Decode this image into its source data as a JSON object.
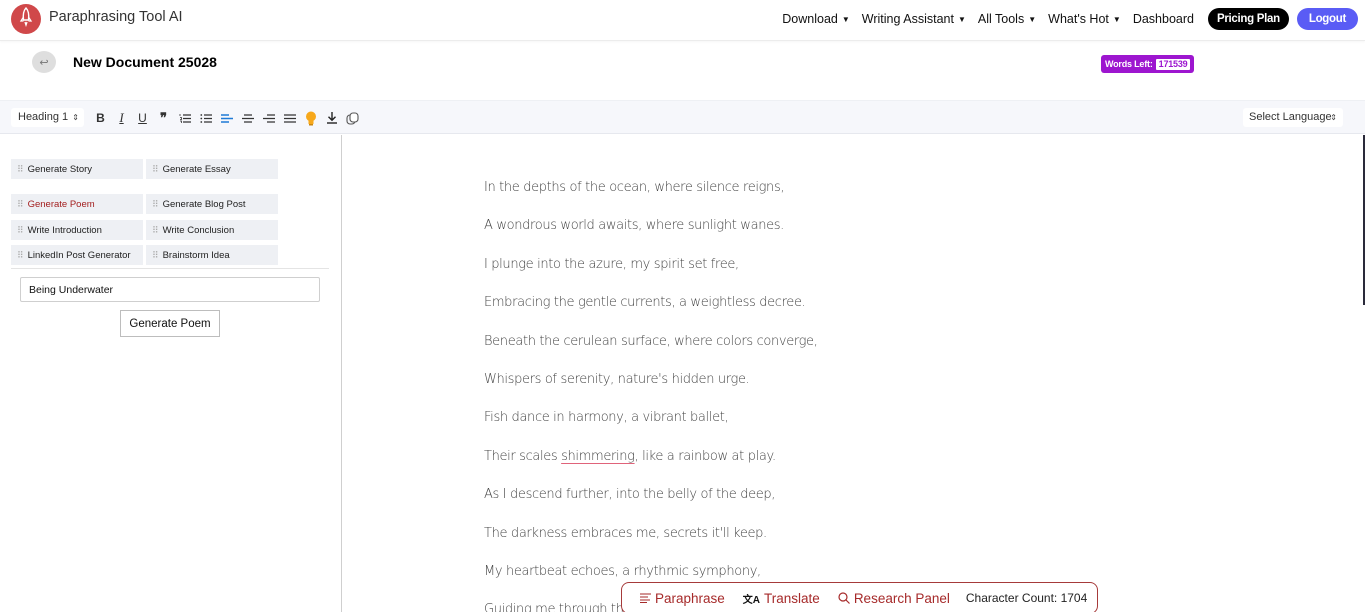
{
  "app": {
    "brand": "Paraphrasing Tool AI",
    "logo_icon": "rocket-icon",
    "brand_color": "#d0484a"
  },
  "nav": {
    "items": [
      {
        "label": "Download",
        "has_dropdown": true
      },
      {
        "label": "Writing Assistant",
        "has_dropdown": true
      },
      {
        "label": "All Tools",
        "has_dropdown": true
      },
      {
        "label": "What's Hot",
        "has_dropdown": true
      },
      {
        "label": "Dashboard",
        "has_dropdown": false
      }
    ],
    "caret": "▼",
    "pricing_label": "Pricing Plan",
    "logout_label": "Logout",
    "logout_color": "#5a5cf5"
  },
  "document": {
    "back_icon": "↩",
    "title": "New Document 25028",
    "words_left_label": "Words Left:",
    "words_left_value": "171539",
    "words_left_color": "#9d16cf"
  },
  "toolbar": {
    "heading_select": "Heading 1",
    "select_arrows": "⇕",
    "buttons": [
      "bold",
      "italic",
      "underline",
      "blockquote",
      "ordered-list",
      "bullet-list",
      "align-left",
      "align-center",
      "align-right",
      "justify",
      "idea",
      "download",
      "copy"
    ],
    "bold_glyph": "B",
    "italic_glyph": "I",
    "underline_glyph": "U",
    "quote_glyph": "❞",
    "language_select": "Select Language"
  },
  "tools": {
    "grip": "⠿",
    "items": [
      {
        "label": "Generate Story",
        "active": false
      },
      {
        "label": "Generate Essay",
        "active": false
      },
      {
        "label": "Generate Poem",
        "active": true
      },
      {
        "label": "Generate Blog Post",
        "active": false
      },
      {
        "label": "Write Introduction",
        "active": false
      },
      {
        "label": "Write Conclusion",
        "active": false
      },
      {
        "label": "LinkedIn Post Generator",
        "active": false
      },
      {
        "label": "Brainstorm Idea",
        "active": false
      }
    ],
    "topic_value": "Being Underwater",
    "generate_label": "Generate Poem"
  },
  "editor": {
    "lines": [
      "In the depths of the ocean, where silence reigns,",
      "A wondrous world awaits, where sunlight wanes.",
      "I plunge into the azure, my spirit set free,",
      "Embracing the gentle currents, a weightless decree.",
      "Beneath the cerulean surface, where colors converge,",
      "Whispers of serenity, nature's hidden urge.",
      "Fish dance in harmony, a vibrant ballet,",
      "Their scales shimmering, like a rainbow at play.",
      "As I descend further, into the belly of the deep,",
      "The darkness embraces me, secrets it'll keep.",
      "My heartbeat echoes, a rhythmic symphony,",
      "Guiding me through the"
    ],
    "line8_before": "Their scales ",
    "line8_misspelled": "shimmering",
    "line8_after": ", like a rainbow at play."
  },
  "action_bar": {
    "paraphrase_icon": "≡",
    "paraphrase_label": "Paraphrase",
    "translate_icon": "文A",
    "translate_label": "Translate",
    "research_icon": "⌕",
    "research_label": "Research Panel",
    "char_count_label": "Character Count: 1704",
    "accent_color": "#a62a2a"
  }
}
